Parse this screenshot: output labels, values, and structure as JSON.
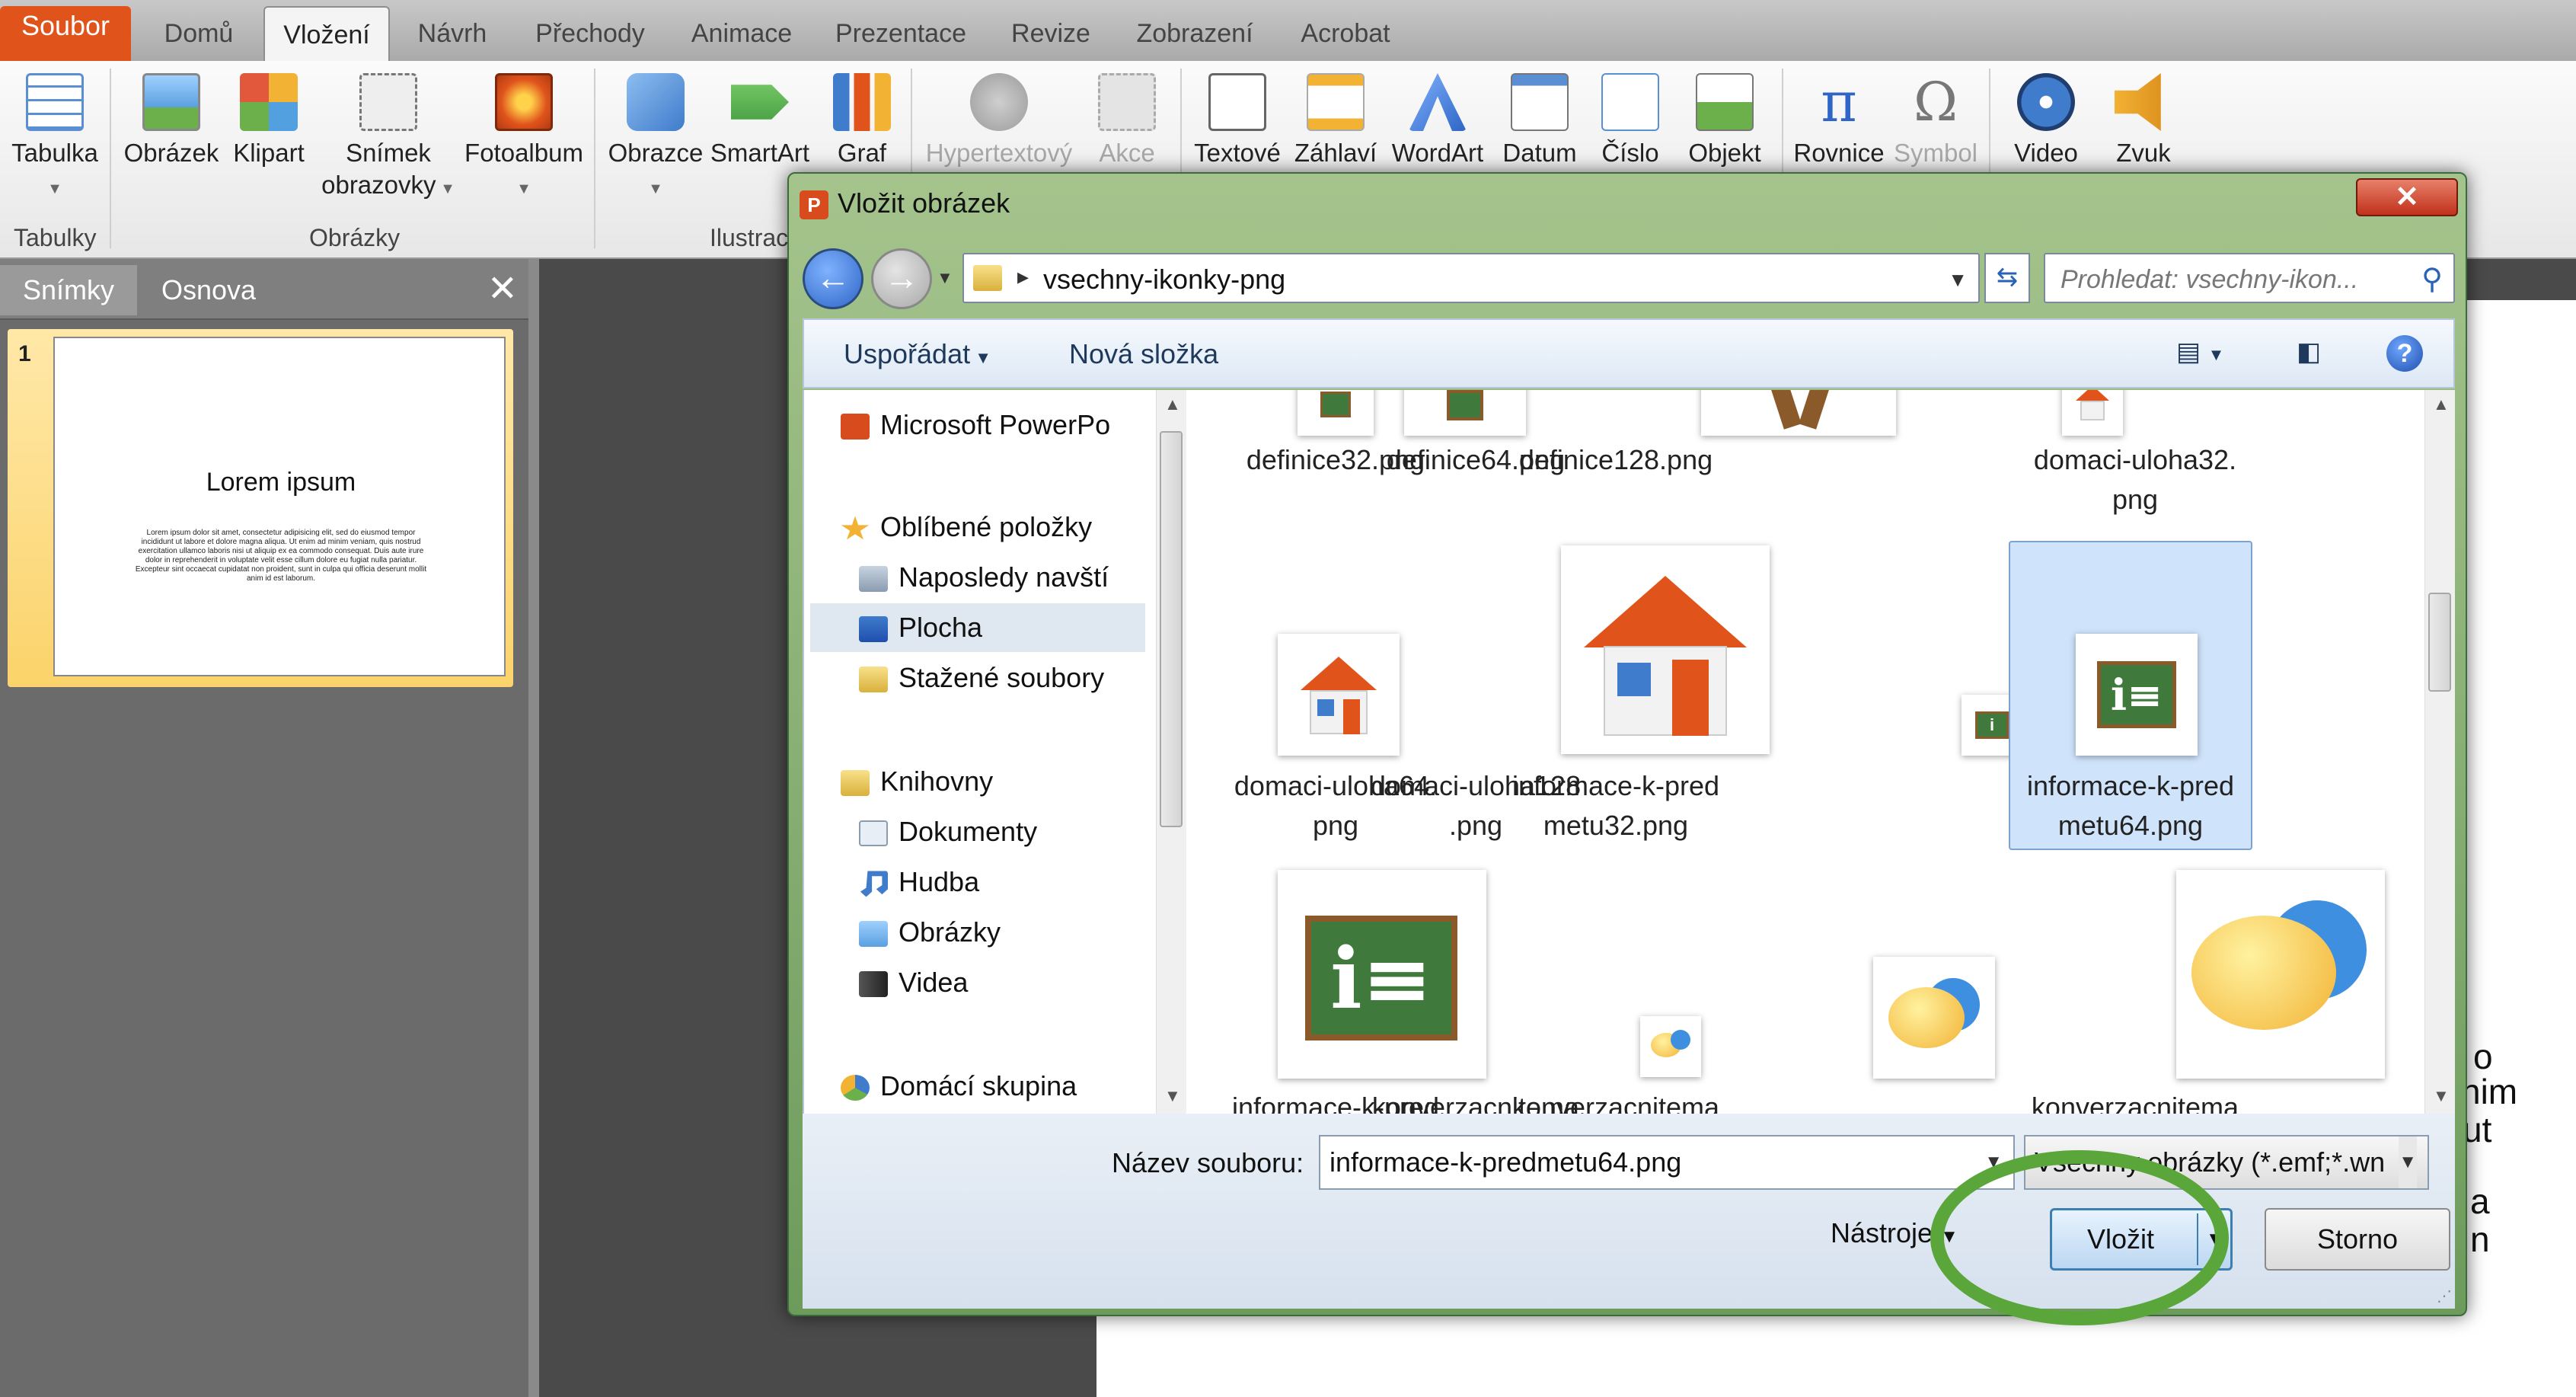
{
  "ribbon_tabs": [
    "Soubor",
    "Domů",
    "Vložení",
    "Návrh",
    "Přechody",
    "Animace",
    "Prezentace",
    "Revize",
    "Zobrazení",
    "Acrobat"
  ],
  "ribbon": {
    "tabulka": "Tabulka",
    "obrazek": "Obrázek",
    "klipart": "Klipart",
    "snimek1": "Snímek",
    "snimek2": "obrazovky",
    "fotoalbum": "Fotoalbum",
    "obrazce": "Obrazce",
    "smartart": "SmartArt",
    "graf": "Graf",
    "hypertext": "Hypertextový",
    "akce": "Akce",
    "textove": "Textové",
    "zahlavi": "Záhlaví",
    "wordart": "WordArt",
    "datum": "Datum",
    "cislo": "Číslo",
    "objekt": "Objekt",
    "rovnice": "Rovnice",
    "symbol": "Symbol",
    "video": "Video",
    "zvuk": "Zvuk",
    "group_tabulky": "Tabulky",
    "group_obrazky": "Obrázky",
    "group_ilustrace": "Ilustrac"
  },
  "panel": {
    "tab_slides": "Snímky",
    "tab_outline": "Osnova",
    "slide_number": "1",
    "slide_title": "Lorem ipsum",
    "slide_body": "Lorem ipsum dolor sit amet, consectetur adipisicing elit, sed do eiusmod tempor incididunt ut labore et dolore magna aliqua. Ut enim ad minim veniam, quis nostrud exercitation ullamco laboris nisi ut aliquip ex ea commodo consequat. Duis aute irure dolor in reprehenderit in voluptate velit esse cillum dolore eu fugiat nulla pariatur. Excepteur sint occaecat cupidatat non proident, sunt in culpa qui officia deserunt mollit anim id est laborum."
  },
  "bg_text": [
    "o",
    "nim",
    "ut",
    "a",
    "n"
  ],
  "dialog": {
    "title": "Vložit obrázek",
    "close": "✕",
    "path": "vsechny-ikonky-png",
    "search_placeholder": "Prohledat: vsechny-ikon...",
    "organize": "Uspořádat",
    "new_folder": "Nová složka",
    "help": "?",
    "nav": [
      "Microsoft PowerPo",
      "Oblíbené položky",
      "Naposledy navští",
      "Plocha",
      "Stažené soubory",
      "Knihovny",
      "Dokumenty",
      "Hudba",
      "Obrázky",
      "Videa",
      "Domácí skupina"
    ],
    "files": [
      "definice32.png",
      "definice64.png",
      "definice128.png",
      "domaci-uloha32.\npng",
      "domaci-uloha64.\npng",
      "domaci-uloha128\n.png",
      "informace-k-pred\nmetu32.png",
      "informace-k-pred\nmetu64.png",
      "informace-k-pred",
      "konverzacnitema",
      "konverzacnitema",
      "konverzacnitema"
    ],
    "filename_label": "Název souboru:",
    "filename_value": "informace-k-predmetu64.png",
    "filetype": "Všechny obrázky (*.emf;*.wn",
    "tools": "Nástroje",
    "insert": "Vložit",
    "cancel": "Storno"
  },
  "colors": {
    "file_tab": "#e0541c",
    "highlight_circle": "#5aa63a",
    "selection": "#cfe3fb"
  }
}
